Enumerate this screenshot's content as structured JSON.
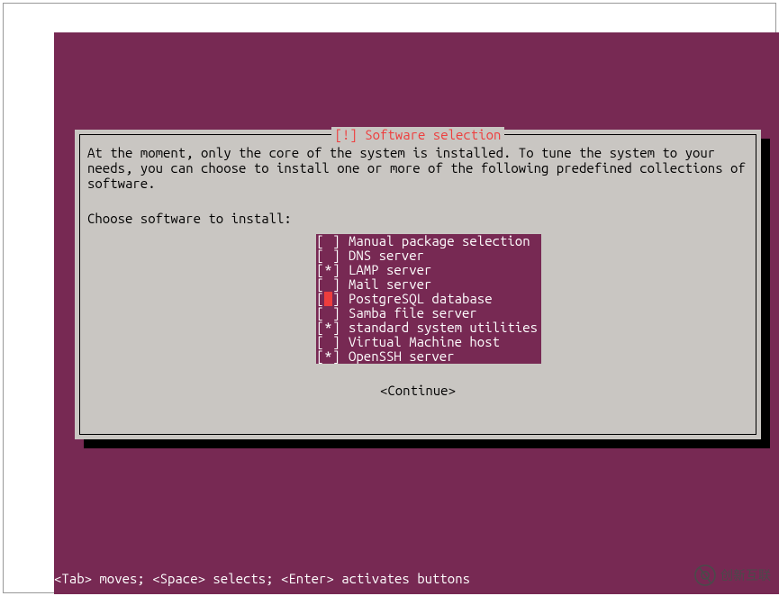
{
  "colors": {
    "bg": "#772953",
    "dialog": "#c9c6c2",
    "accent": "#ee3d3d"
  },
  "dialog": {
    "title": "[!] Software selection",
    "body": "At the moment, only the core of the system is installed. To tune the system to your needs, you can choose to install one or more of the following predefined collections of software.",
    "prompt": "Choose software to install:",
    "continue": "<Continue>"
  },
  "list": [
    {
      "mark": " ",
      "cursor": false,
      "label": "Manual package selection"
    },
    {
      "mark": " ",
      "cursor": false,
      "label": "DNS server"
    },
    {
      "mark": "*",
      "cursor": false,
      "label": "LAMP server"
    },
    {
      "mark": " ",
      "cursor": false,
      "label": "Mail server"
    },
    {
      "mark": " ",
      "cursor": true,
      "label": "PostgreSQL database"
    },
    {
      "mark": " ",
      "cursor": false,
      "label": "Samba file server"
    },
    {
      "mark": "*",
      "cursor": false,
      "label": "standard system utilities"
    },
    {
      "mark": " ",
      "cursor": false,
      "label": "Virtual Machine host"
    },
    {
      "mark": "*",
      "cursor": false,
      "label": "OpenSSH server"
    }
  ],
  "hint": "<Tab> moves; <Space> selects; <Enter> activates buttons",
  "watermark": {
    "text": "创新互联"
  }
}
